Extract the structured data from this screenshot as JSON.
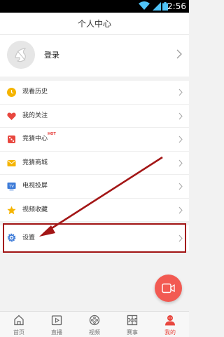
{
  "status_bar": {
    "time": "2:56"
  },
  "header": {
    "title": "个人中心"
  },
  "profile": {
    "login_label": "登录"
  },
  "menu": {
    "items": [
      {
        "label": "观看历史",
        "icon": "clock-icon",
        "color": "#f5b400"
      },
      {
        "label": "我的关注",
        "icon": "heart-icon",
        "color": "#f25a52"
      },
      {
        "label": "竞猜中心",
        "badge": "HOT",
        "icon": "dice-icon",
        "color": "#f25a52"
      },
      {
        "label": "竞猜商城",
        "icon": "mail-icon",
        "color": "#f5b400"
      },
      {
        "label": "电视投屏",
        "icon": "tv-icon",
        "color": "#3d7bd8"
      },
      {
        "label": "视频收藏",
        "icon": "star-icon",
        "color": "#f5b400"
      }
    ]
  },
  "settings": {
    "label": "设置",
    "icon": "gear-icon",
    "color": "#3d7bd8"
  },
  "tabs": [
    {
      "label": "首页",
      "icon": "home-icon"
    },
    {
      "label": "直播",
      "icon": "live-icon"
    },
    {
      "label": "视频",
      "icon": "film-icon"
    },
    {
      "label": "赛事",
      "icon": "field-icon"
    },
    {
      "label": "我的",
      "icon": "profile-icon",
      "active": true
    }
  ],
  "accent_color": "#e8473f",
  "annotation_color": "#a31616"
}
